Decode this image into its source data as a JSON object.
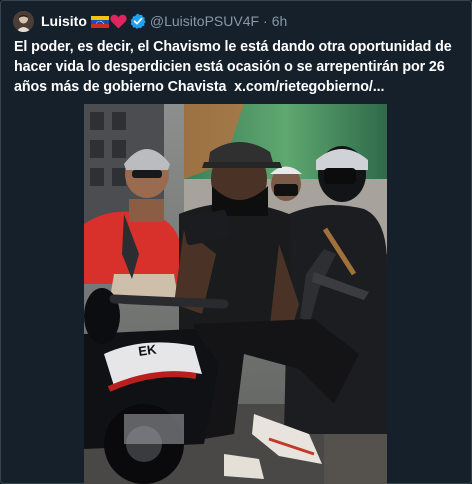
{
  "tweet": {
    "author": {
      "display_name": "Luisito",
      "emoji": [
        "venezuela-flag",
        "red-heart"
      ],
      "verified": true,
      "handle": "@LuisitoPSUV4F",
      "separator": "·",
      "time": "6h"
    },
    "text": "El poder, es decir, el Chavismo le está dando otra oportunidad de hacer vida lo desperdicien está ocasión o se arrepentirán por 26 años más de gobierno Chavista",
    "link": "x.com/rietegobierno/...",
    "colors": {
      "background": "#15202b",
      "border": "#38444d",
      "secondary_text": "#8899a6",
      "verified": "#1da1f2"
    }
  }
}
